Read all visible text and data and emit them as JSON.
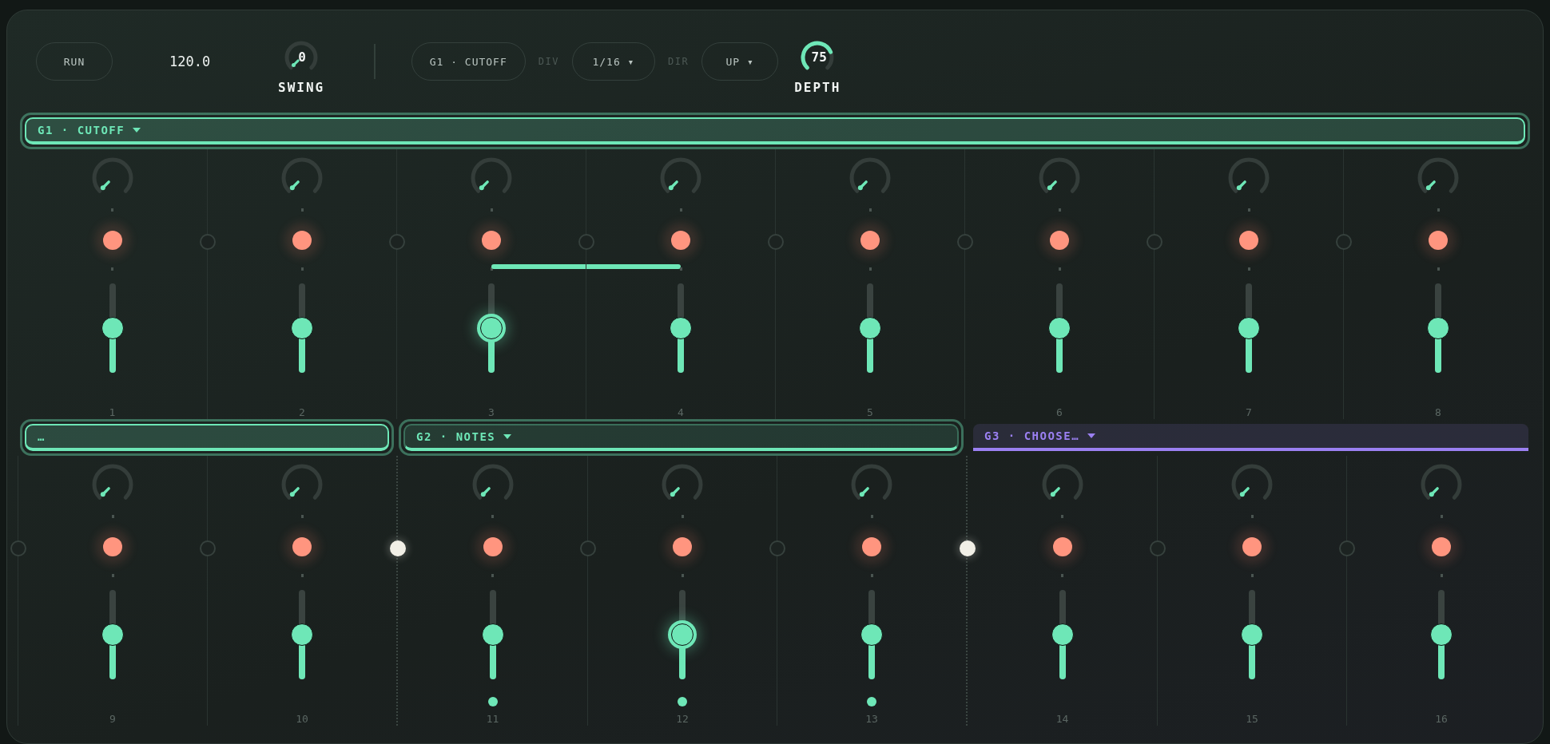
{
  "transport": {
    "run": "RUN",
    "tempo": "120.0",
    "swing": {
      "value": "0",
      "label": "SWING"
    }
  },
  "modulation": {
    "target": "G1 · CUTOFF",
    "div_label": "DIV",
    "div": "1/16 ▾",
    "dir_label": "DIR",
    "dir": "UP ▾",
    "depth": {
      "value": "75",
      "label": "DEPTH",
      "level": 0.75
    }
  },
  "rows": [
    {
      "groups": [
        {
          "label": "G1 · CUTOFF",
          "color": "#6ee7b7",
          "selected": true,
          "outlined": true,
          "steps": [
            {
              "number": "1",
              "on": true,
              "level": 0.5,
              "focused": false,
              "tie": false,
              "marker": false
            },
            {
              "number": "2",
              "on": true,
              "level": 0.5,
              "focused": false,
              "tie": false,
              "marker": false,
              "link": false
            },
            {
              "number": "3",
              "on": true,
              "level": 0.5,
              "focused": true,
              "tie": true,
              "marker": false,
              "link": false
            },
            {
              "number": "4",
              "on": true,
              "level": 0.5,
              "focused": false,
              "tie": false,
              "marker": false,
              "link": false
            },
            {
              "number": "5",
              "on": true,
              "level": 0.5,
              "focused": false,
              "tie": false,
              "marker": false,
              "link": false
            },
            {
              "number": "6",
              "on": true,
              "level": 0.5,
              "focused": false,
              "tie": false,
              "marker": false,
              "link": false
            },
            {
              "number": "7",
              "on": true,
              "level": 0.5,
              "focused": false,
              "tie": false,
              "marker": false,
              "link": false
            },
            {
              "number": "8",
              "on": true,
              "level": 0.5,
              "focused": false,
              "tie": false,
              "marker": false,
              "link": false
            }
          ]
        }
      ]
    },
    {
      "groups": [
        {
          "label": "…",
          "color": "#6ee7b7",
          "selected": true,
          "outlined": true,
          "steps": [
            {
              "number": "9",
              "on": true,
              "level": 0.5,
              "focused": false,
              "tie": false,
              "marker": false,
              "link": false
            },
            {
              "number": "10",
              "on": true,
              "level": 0.5,
              "focused": false,
              "tie": false,
              "marker": false,
              "link": false
            }
          ]
        },
        {
          "label": "G2 · NOTES",
          "color": "#6ee7b7",
          "selected": false,
          "outlined": true,
          "steps": [
            {
              "number": "11",
              "on": true,
              "level": 0.5,
              "focused": false,
              "tie": false,
              "marker": true,
              "link": true
            },
            {
              "number": "12",
              "on": true,
              "level": 0.5,
              "focused": true,
              "tie": false,
              "marker": true,
              "link": false
            },
            {
              "number": "13",
              "on": true,
              "level": 0.5,
              "focused": false,
              "tie": false,
              "marker": true,
              "link": false
            }
          ]
        },
        {
          "label": "G3 · CHOOSE…",
          "color": "#9b80f2",
          "selected": false,
          "outlined": false,
          "steps": [
            {
              "number": "14",
              "on": true,
              "level": 0.5,
              "focused": false,
              "tie": false,
              "marker": false,
              "link": true
            },
            {
              "number": "15",
              "on": true,
              "level": 0.5,
              "focused": false,
              "tie": false,
              "marker": false,
              "link": false
            },
            {
              "number": "16",
              "on": true,
              "level": 0.5,
              "focused": false,
              "tie": false,
              "marker": false,
              "link": false
            }
          ]
        }
      ]
    }
  ]
}
